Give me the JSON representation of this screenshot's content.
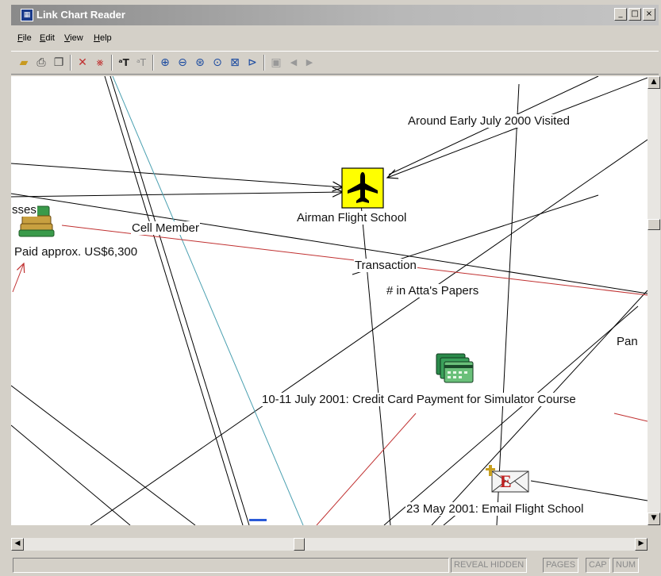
{
  "window": {
    "title": "Link Chart Reader",
    "icon": "app-icon",
    "controls": [
      "_",
      "□",
      "×"
    ]
  },
  "menu": [
    {
      "accel": "F",
      "rest": "ile"
    },
    {
      "accel": "E",
      "rest": "dit"
    },
    {
      "accel": "V",
      "rest": "iew"
    },
    {
      "accel": "H",
      "rest": "elp"
    }
  ],
  "toolbar": {
    "icons": [
      "open-icon",
      "print-icon",
      "copy-icon",
      "link-add-icon",
      "link-remove-icon",
      "text-large-icon",
      "text-small-icon",
      "zoom-in-icon",
      "zoom-out-icon",
      "zoom-window-icon",
      "zoom-reset-icon",
      "fit-page-icon",
      "expand-icon",
      "camera-icon",
      "back-icon",
      "forward-icon"
    ]
  },
  "chart": {
    "nodes": {
      "flight_school": {
        "label": "Airman Flight School",
        "icon": "airplane-icon",
        "accent": "#ffff00"
      },
      "money": {
        "label": "Paid approx. US$6,300",
        "clipped_label": "sses",
        "icon": "money-stack-icon"
      },
      "credit_card": {
        "label": "10-11 July 2001: Credit Card Payment for Simulator Course",
        "icon": "credit-card-icon"
      },
      "email": {
        "label": "23 May 2001: Email Flight School",
        "icon": "email-icon"
      }
    },
    "links": {
      "visited": "Around Early July 2000 Visited",
      "cell_member": "Cell Member",
      "transaction": "Transaction",
      "atta_papers": "# in Atta's Papers",
      "pan": "Pan"
    },
    "colors": {
      "line": "#000000",
      "transaction": "#c03030",
      "highlight": "#4aa0b0"
    }
  },
  "status": {
    "panels": [
      "REVEAL HIDDEN",
      "PAGES",
      "CAP",
      "NUM"
    ]
  }
}
